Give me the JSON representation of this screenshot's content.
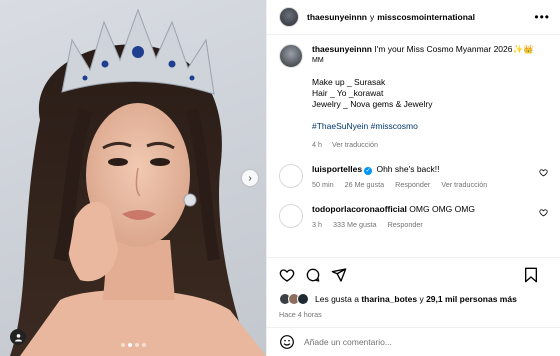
{
  "header": {
    "username": "thaesunyeinnn",
    "conjunction": "y",
    "collaborator": "misscosmointernational",
    "more_label": "•••"
  },
  "caption": {
    "username": "thaesunyeinnn",
    "line1": "I'm your Miss Cosmo Myanmar 2026",
    "line1_suffix": "MM",
    "credits": [
      "Make up _ Surasak",
      "Hair _ Yo _korawat",
      "Jewelry _ Nova gems & Jewelry"
    ],
    "hashtags": "#ThaeSuNyein #misscosmo",
    "time": "4 h",
    "see_translation": "Ver traducción"
  },
  "comments": [
    {
      "username": "luisportelles",
      "verified": true,
      "text": "Ohh she's back!!",
      "time": "50 min",
      "likes": "26 Me gusta",
      "reply": "Responder",
      "translate": "Ver traducción"
    },
    {
      "username": "todoporlacoronaofficial",
      "verified": false,
      "text": "OMG OMG OMG",
      "time": "3 h",
      "likes": "333 Me gusta",
      "reply": "Responder"
    }
  ],
  "likes": {
    "prefix": "Les gusta a",
    "user": "tharina_botes",
    "middle": "y",
    "others": "29,1 mil personas más"
  },
  "posted_ago": "Hace 4 horas",
  "comment_input": {
    "placeholder": "Añade un comentario..."
  },
  "photo": {
    "slide_count": 4,
    "active_slide": 2
  },
  "colors": {
    "link": "#00376b",
    "muted": "#737373",
    "verified": "#0095f6",
    "border": "#efefef"
  },
  "icons": [
    "heart-icon",
    "comment-icon",
    "share-icon",
    "bookmark-icon",
    "emoji-icon",
    "chevron-right-icon",
    "user-tag-icon"
  ]
}
